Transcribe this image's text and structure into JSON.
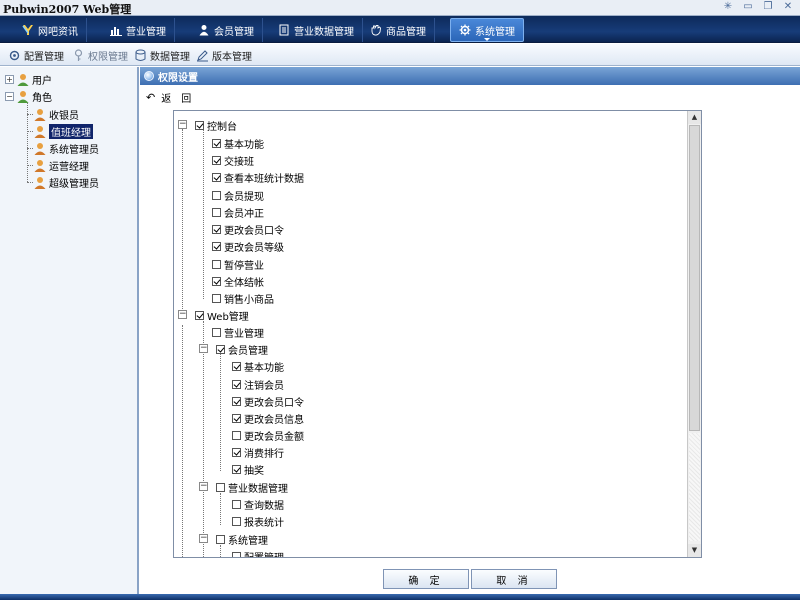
{
  "window": {
    "title": "Pubwin2007 Web管理"
  },
  "main_nav": [
    {
      "label": "网吧资讯",
      "icon": "logo-icon"
    },
    {
      "label": "营业管理",
      "icon": "bar-chart-icon"
    },
    {
      "label": "会员管理",
      "icon": "user-icon"
    },
    {
      "label": "营业数据管理",
      "icon": "document-icon"
    },
    {
      "label": "商品管理",
      "icon": "hand-icon"
    },
    {
      "label": "系统管理",
      "icon": "gear-icon",
      "active": true
    }
  ],
  "sub_toolbar": [
    {
      "label": "配置管理",
      "icon": "gear-icon"
    },
    {
      "label": "权限管理",
      "icon": "key-icon",
      "dim": true
    },
    {
      "label": "数据管理",
      "icon": "database-icon"
    },
    {
      "label": "版本管理",
      "icon": "pencil-icon"
    }
  ],
  "left_tree": {
    "user": "用户",
    "role": "角色",
    "roles": [
      "收银员",
      "值班经理",
      "系统管理员",
      "运营经理",
      "超级管理员"
    ],
    "selected_index": 1
  },
  "panel": {
    "title": "权限设置",
    "back_label": "返　回"
  },
  "permissions": {
    "group1": {
      "label": "控制台",
      "items": [
        {
          "label": "基本功能",
          "checked": true
        },
        {
          "label": "交接班",
          "checked": true
        },
        {
          "label": "查看本班统计数据",
          "checked": true
        },
        {
          "label": "会员提现",
          "checked": false
        },
        {
          "label": "会员冲正",
          "checked": false
        },
        {
          "label": "更改会员口令",
          "checked": true
        },
        {
          "label": "更改会员等级",
          "checked": true
        },
        {
          "label": "暂停营业",
          "checked": false
        },
        {
          "label": "全体结帐",
          "checked": true
        },
        {
          "label": "销售小商品",
          "checked": false
        }
      ]
    },
    "group2": {
      "label": "Web管理",
      "sub1": "营业管理",
      "sub2": {
        "label": "会员管理",
        "items": [
          {
            "label": "基本功能",
            "checked": true
          },
          {
            "label": "注销会员",
            "checked": true
          },
          {
            "label": "更改会员口令",
            "checked": true
          },
          {
            "label": "更改会员信息",
            "checked": true
          },
          {
            "label": "更改会员金额",
            "checked": false
          },
          {
            "label": "消费排行",
            "checked": true
          },
          {
            "label": "抽奖",
            "checked": true
          }
        ]
      },
      "sub3": {
        "label": "营业数据管理",
        "items": [
          {
            "label": "查询数据",
            "checked": false
          },
          {
            "label": "报表统计",
            "checked": false
          }
        ]
      },
      "sub4": {
        "label": "系统管理",
        "items": [
          {
            "label": "配置管理",
            "checked": false
          }
        ]
      }
    }
  },
  "buttons": {
    "ok": "确 定",
    "cancel": "取 消"
  }
}
